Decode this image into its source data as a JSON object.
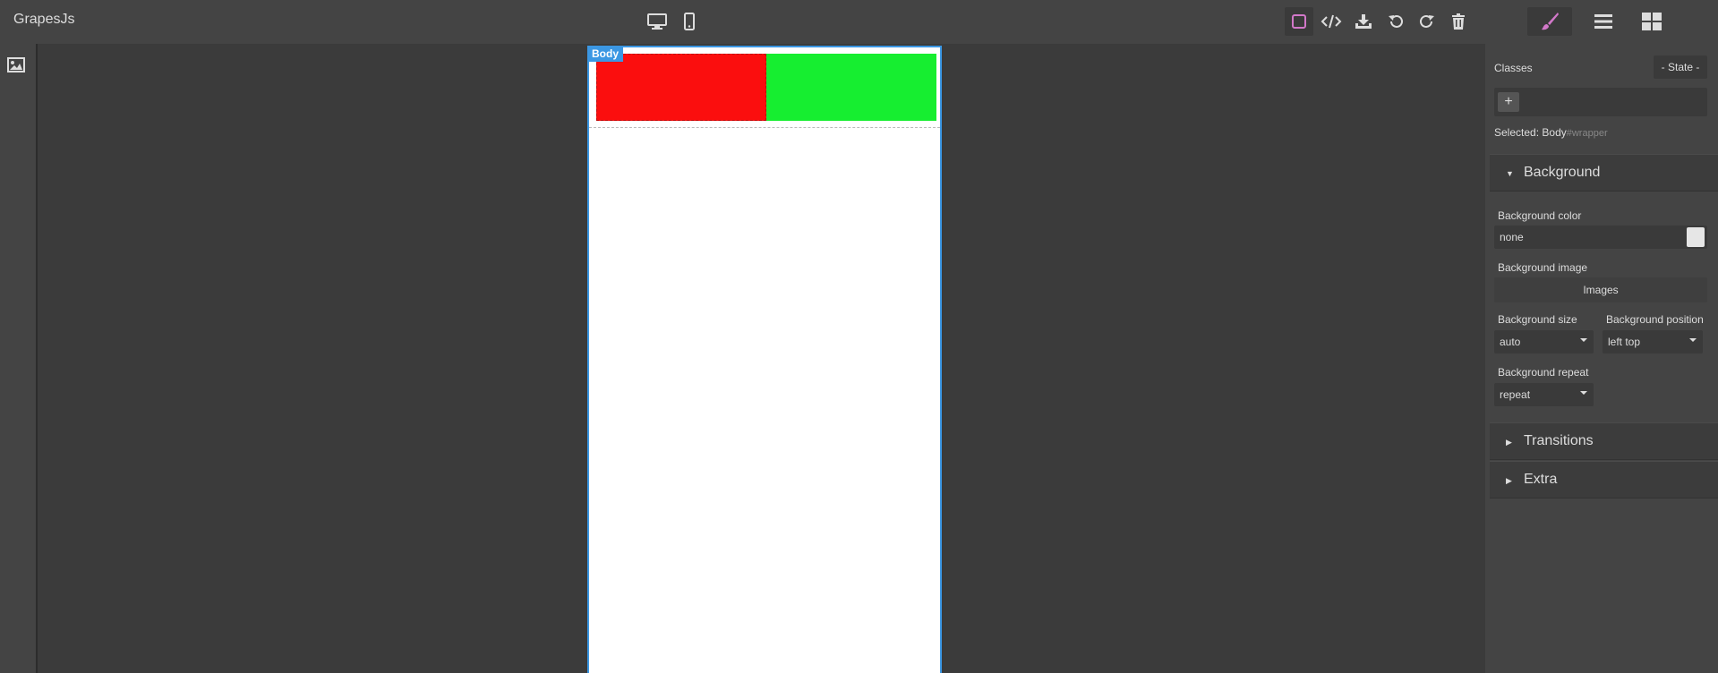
{
  "app": {
    "title": "GrapesJs"
  },
  "toolbar": {
    "devices": [
      {
        "name": "desktop-icon"
      },
      {
        "name": "mobile-icon"
      }
    ],
    "options": [
      {
        "name": "sw-visibility-icon",
        "active": true
      },
      {
        "name": "code-icon"
      },
      {
        "name": "download-icon"
      },
      {
        "name": "undo-icon"
      },
      {
        "name": "redo-icon"
      },
      {
        "name": "trash-icon"
      }
    ],
    "views": [
      {
        "name": "paint-brush-icon",
        "active": true
      },
      {
        "name": "layers-icon"
      },
      {
        "name": "blocks-icon"
      }
    ]
  },
  "left": {
    "asset_button": "image-icon"
  },
  "canvas": {
    "badge": "Body",
    "colors": {
      "red": "#fb0e0e",
      "green": "#16ee30",
      "highlight": "#3b97e3"
    }
  },
  "panel": {
    "classes_label": "Classes",
    "state_select": "- State -",
    "add_label": "+",
    "selected_label": "Selected:",
    "selected_name": "Body",
    "selected_id": "#wrapper",
    "sectors": {
      "background": "Background",
      "transitions": "Transitions",
      "extra": "Extra"
    },
    "bg_color": {
      "label": "Background color",
      "value": "none"
    },
    "bg_image": {
      "label": "Background image",
      "button": "Images"
    },
    "bg_size": {
      "label": "Background size",
      "value": "auto"
    },
    "bg_position": {
      "label": "Background position",
      "value": "left top"
    },
    "bg_repeat": {
      "label": "Background repeat",
      "value": "repeat"
    }
  },
  "accent": "#d278c9"
}
